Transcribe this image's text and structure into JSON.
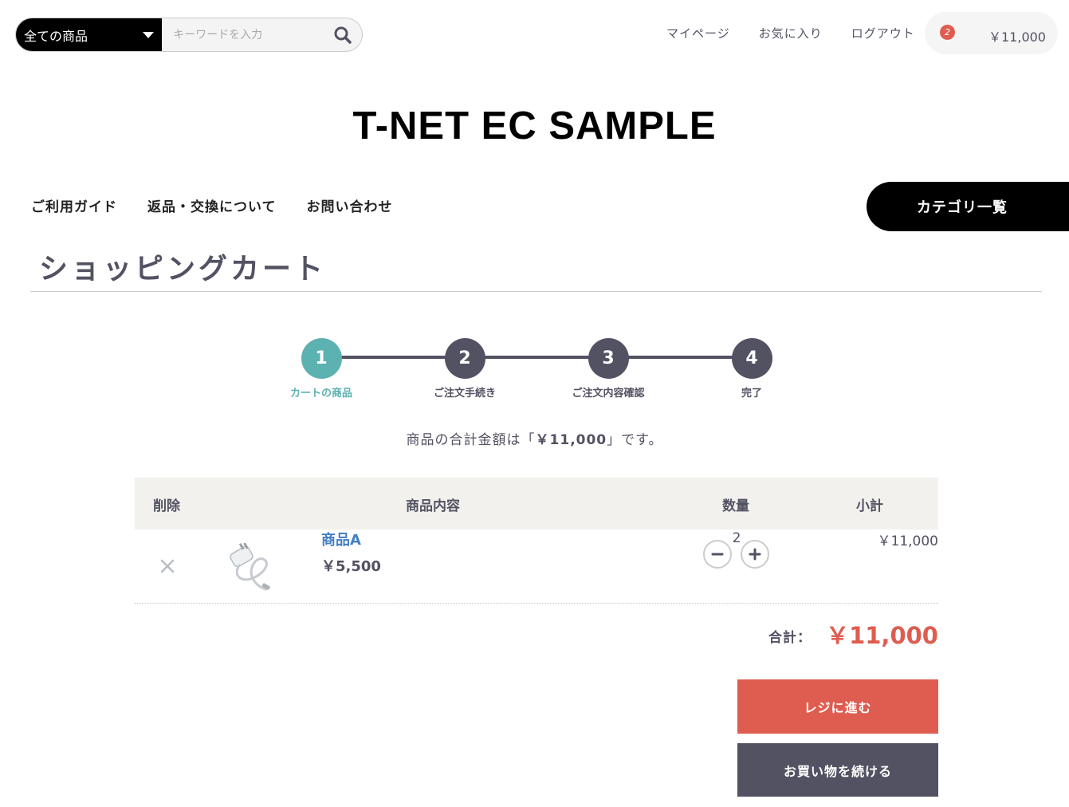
{
  "header": {
    "category_select": "全ての商品",
    "search_placeholder": "キーワードを入力",
    "nav": [
      "マイページ",
      "お気に入り",
      "ログアウト"
    ],
    "cart_count": "2",
    "cart_total": "￥11,000"
  },
  "site_title": "T-NET EC SAMPLE",
  "main_nav": [
    "ご利用ガイド",
    "返品・交換について",
    "お問い合わせ"
  ],
  "category_list_button": "カテゴリ一覧",
  "page_title": "ショッピングカート",
  "steps": [
    {
      "num": "1",
      "label": "カートの商品",
      "active": true
    },
    {
      "num": "2",
      "label": "ご注文手続き",
      "active": false
    },
    {
      "num": "3",
      "label": "ご注文内容確認",
      "active": false
    },
    {
      "num": "4",
      "label": "完了",
      "active": false
    }
  ],
  "total_message": {
    "before": "商品の合計金額は「",
    "amount": "￥11,000",
    "after": "」です。"
  },
  "table": {
    "headers": {
      "delete": "削除",
      "content": "商品内容",
      "quantity": "数量",
      "subtotal": "小計"
    },
    "rows": [
      {
        "name": "商品A",
        "price": "￥5,500",
        "quantity": "2",
        "subtotal": "￥11,000"
      }
    ]
  },
  "grand_total_label": "合計：",
  "grand_total_value": "￥11,000",
  "buttons": {
    "checkout": "レジに進む",
    "continue": "お買い物を続ける"
  },
  "colors": {
    "accent_teal": "#5cb1b1",
    "accent_red": "#de5d50",
    "dark_gray": "#525263",
    "link_blue": "#437ec4"
  }
}
